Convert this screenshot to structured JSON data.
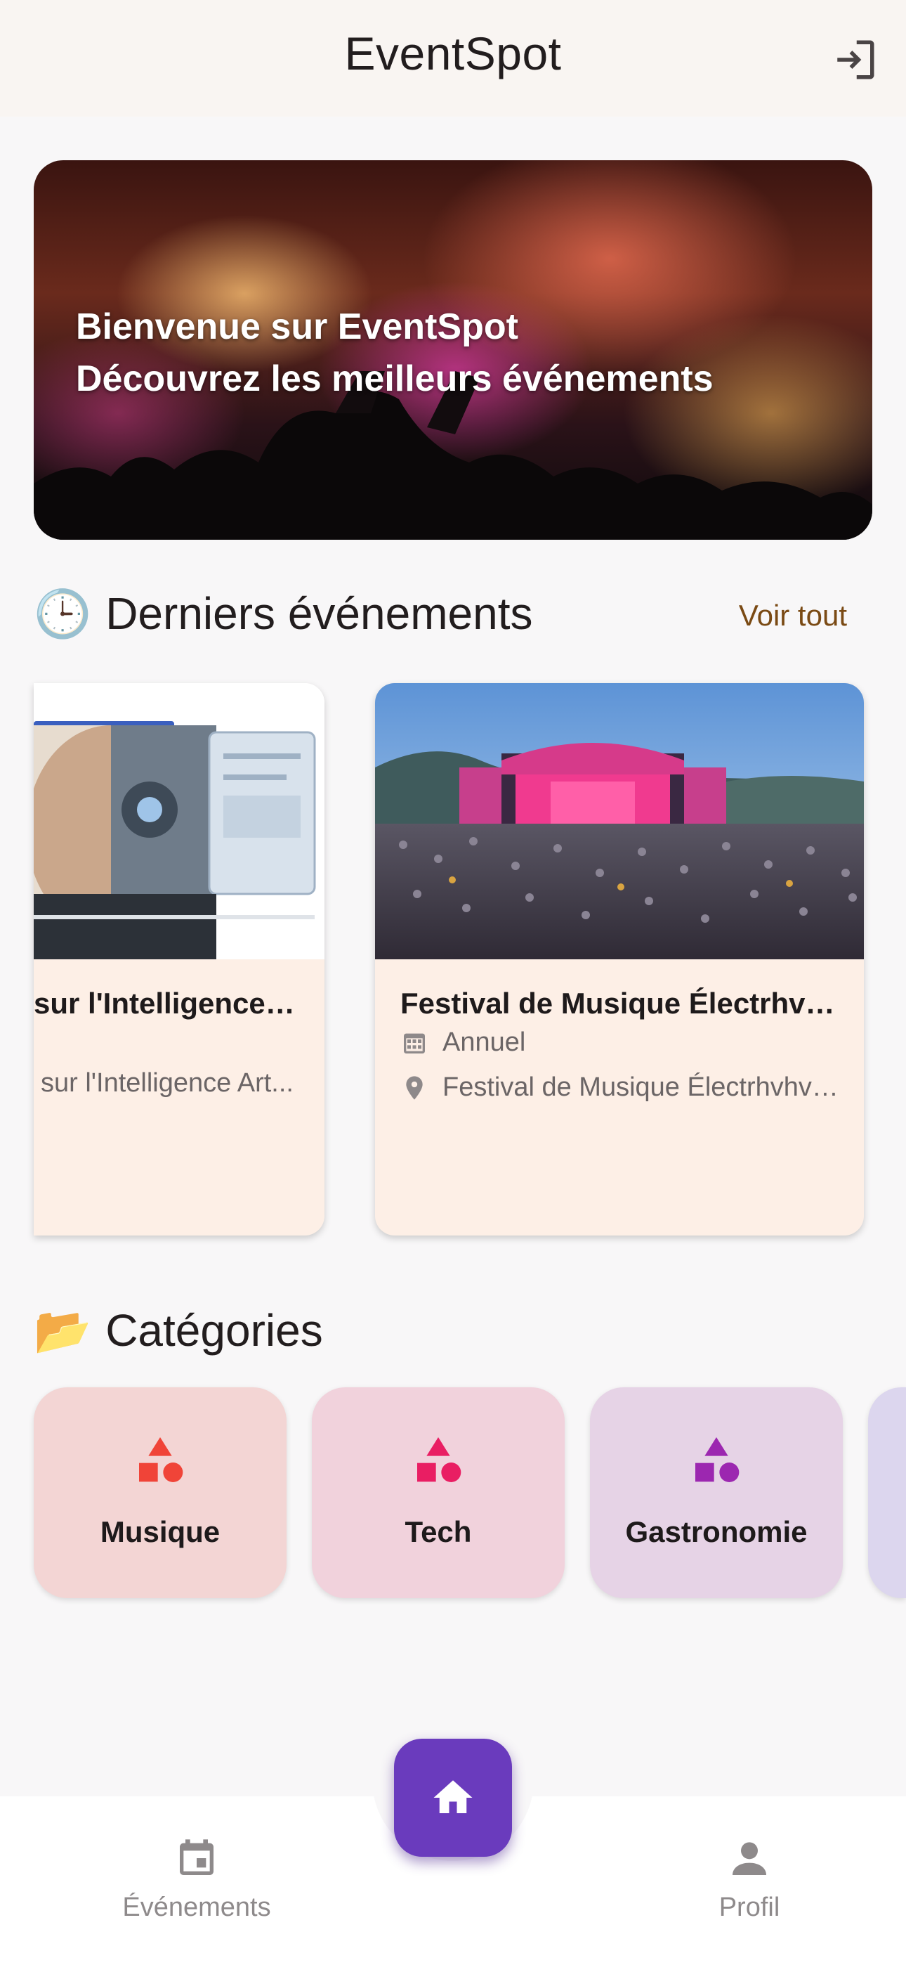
{
  "app": {
    "title": "EventSpot"
  },
  "hero": {
    "line1": "Bienvenue sur EventSpot",
    "line2": "Découvrez les meilleurs événements"
  },
  "latest": {
    "emoji": "🕒",
    "title": "Derniers événements",
    "see_all": "Voir tout",
    "events": [
      {
        "title": "Conférence sur l'Intelligence Artificielle",
        "title_visible": "sur l'Intelligence Ar...",
        "schedule": "",
        "location": "Conférence sur l'Intelligence Artificielle",
        "location_visible": "sur l'Intelligence Art..."
      },
      {
        "title": "Festival de Musique Électrhvhvhvh",
        "schedule": "Annuel",
        "location": "Festival de Musique Électrhvhvhvh"
      }
    ]
  },
  "categories": {
    "emoji": "📂",
    "title": "Catégories",
    "items": [
      {
        "label": "Musique",
        "color": "#f04438",
        "bg": "#f3d5d4"
      },
      {
        "label": "Tech",
        "color": "#e91e63",
        "bg": "#f1d2dc"
      },
      {
        "label": "Gastronomie",
        "color": "#9c27b0",
        "bg": "#e6d3e6"
      }
    ]
  },
  "bottom_nav": {
    "events_label": "Événements",
    "profile_label": "Profil",
    "home_color": "#6a3bbd"
  }
}
